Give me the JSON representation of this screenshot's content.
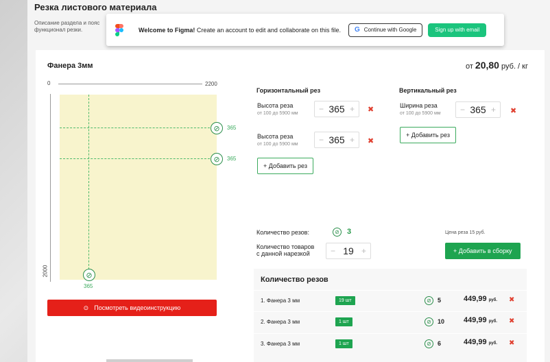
{
  "section": {
    "title": "Резка листового материала",
    "description": "Описание раздела и пояс функционал резки."
  },
  "figma": {
    "welcome_bold": "Welcome to Figma!",
    "welcome_rest": " Create an account to edit and collaborate on this file.",
    "google_label": "Continue with Google",
    "email_label": "Sign up with email"
  },
  "product": {
    "title": "Фанера 3мм",
    "price_prefix": "от",
    "price_value": "20,80",
    "price_unit": "руб. / кг"
  },
  "canvas": {
    "width_label": "2200",
    "height_label": "2000",
    "origin_label": "0",
    "cut_labels": [
      "365",
      "365"
    ],
    "vertical_cut_label": "365"
  },
  "horizontal": {
    "title": "Горизонтальный рез",
    "fields": [
      {
        "label": "Высота реза",
        "range": "от 100 до 5900 мм",
        "value": "365"
      },
      {
        "label": "Высота реза",
        "range": "от 100 до 5900 мм",
        "value": "365"
      }
    ],
    "add_label": "+ Добавить рез"
  },
  "vertical": {
    "title": "Вертикальный рез",
    "fields": [
      {
        "label": "Ширина реза",
        "range": "от 100 до 5900 мм",
        "value": "365"
      }
    ],
    "add_label": "+ Добавить рез"
  },
  "summary": {
    "cuts_label": "Количество резов:",
    "cuts_value": "3",
    "qty_label_1": "Количество товаров",
    "qty_label_2": "с данной нарезкой",
    "qty_value": "19",
    "price_note": "Цена реза 15 руб.",
    "add_cart_label": "+ Добавить в сборку"
  },
  "table": {
    "title": "Количество резов",
    "rows": [
      {
        "name": "1.  Фанера 3 мм",
        "badge": "19 шт",
        "cuts": "5",
        "price": "449,99",
        "unit": "руб."
      },
      {
        "name": "2.  Фанера 3 мм",
        "badge": "1 шт",
        "cuts": "10",
        "price": "449,99",
        "unit": "руб."
      },
      {
        "name": "3.  Фанера 3 мм",
        "badge": "1 шт",
        "cuts": "6",
        "price": "449,99",
        "unit": "руб."
      }
    ]
  },
  "video": {
    "label": "Посмотреть видеоинструкцию"
  },
  "icons": {
    "saw": "saw-blade-icon",
    "delete": "delete-x-icon",
    "play": "play-circle-icon"
  },
  "colors": {
    "accent_green": "#1ea450",
    "figma_green": "#1bc47d",
    "delete_red": "#e04030",
    "video_red": "#e52019",
    "sheet_fill": "#f8f4cd"
  }
}
